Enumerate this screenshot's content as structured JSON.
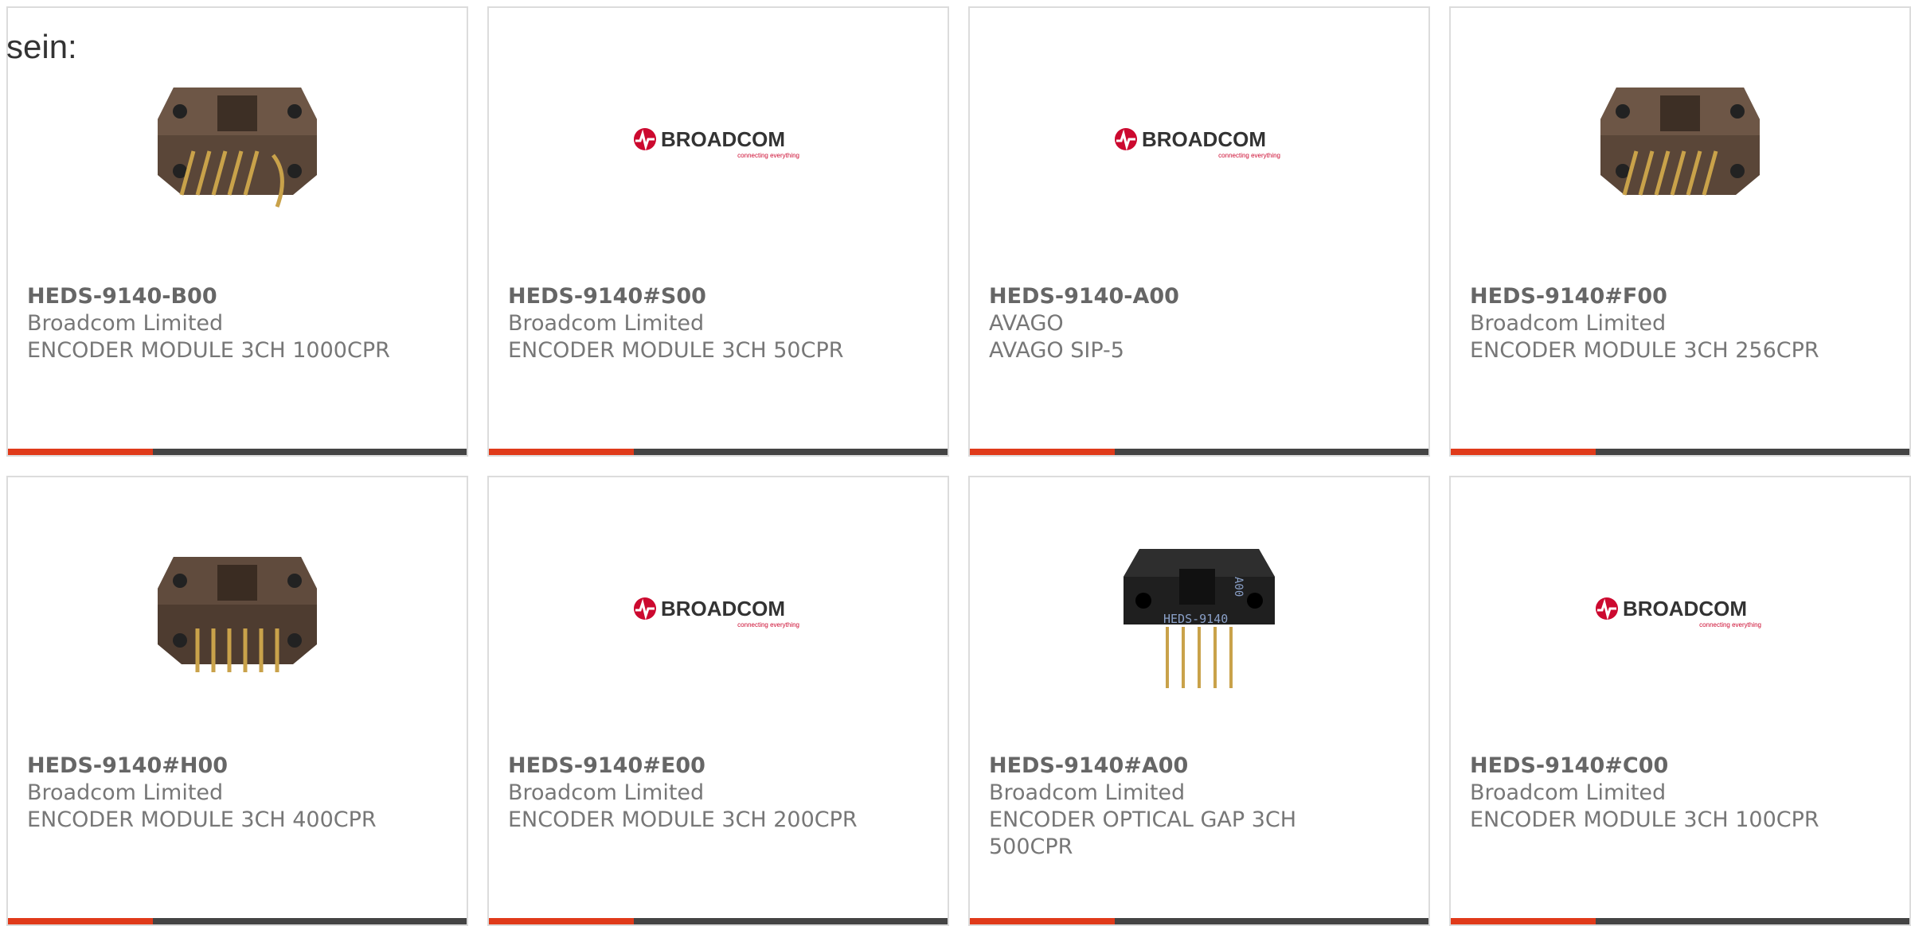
{
  "intro_text": "sein:",
  "brand_logo": {
    "name": "BROADCOM",
    "tagline": "connecting everything",
    "color": "#cc092f"
  },
  "colors": {
    "accent_bar": "#e03a1a",
    "bar": "#444444"
  },
  "products": [
    {
      "part": "HEDS-9140-B00",
      "manufacturer": "Broadcom Limited",
      "description": "ENCODER MODULE 3CH 1000CPR",
      "image": "encoder-module-photo"
    },
    {
      "part": "HEDS-9140#S00",
      "manufacturer": "Broadcom Limited",
      "description": "ENCODER MODULE 3CH 50CPR",
      "image": "broadcom-logo"
    },
    {
      "part": "HEDS-9140-A00",
      "manufacturer": "AVAGO",
      "description": "AVAGO SIP-5",
      "image": "broadcom-logo"
    },
    {
      "part": "HEDS-9140#F00",
      "manufacturer": "Broadcom Limited",
      "description": "ENCODER MODULE 3CH 256CPR",
      "image": "encoder-module-photo"
    },
    {
      "part": "HEDS-9140#H00",
      "manufacturer": "Broadcom Limited",
      "description": "ENCODER MODULE 3CH 400CPR",
      "image": "encoder-module-photo"
    },
    {
      "part": "HEDS-9140#E00",
      "manufacturer": "Broadcom Limited",
      "description": "ENCODER MODULE 3CH 200CPR",
      "image": "broadcom-logo"
    },
    {
      "part": "HEDS-9140#A00",
      "manufacturer": "Broadcom Limited",
      "description": "ENCODER OPTICAL GAP 3CH 500CPR",
      "image": "encoder-black-photo",
      "image_text": "HEDS-9140",
      "image_code": "A00"
    },
    {
      "part": "HEDS-9140#C00",
      "manufacturer": "Broadcom Limited",
      "description": "ENCODER MODULE 3CH 100CPR",
      "image": "broadcom-logo"
    }
  ]
}
